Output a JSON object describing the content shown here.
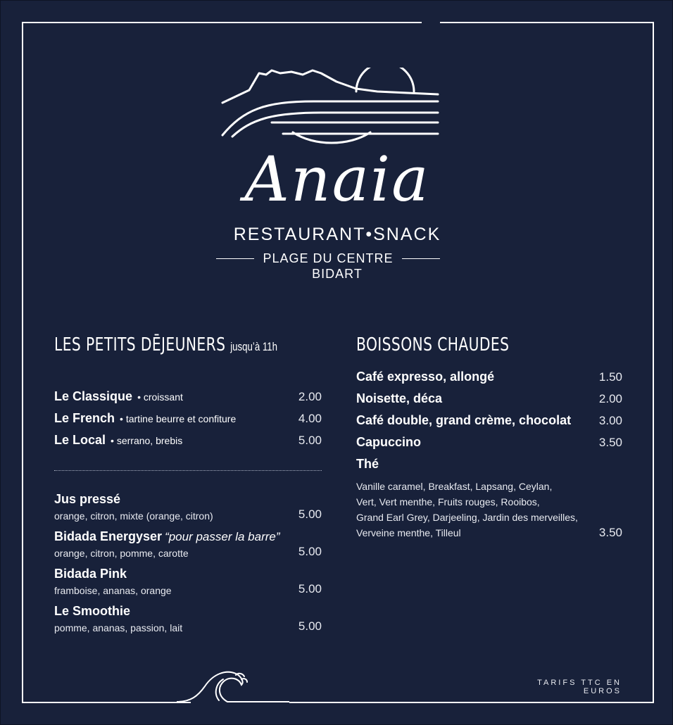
{
  "brand": {
    "name": "Anaia",
    "subtitle": "RESTAURANT•SNACK",
    "place": "PLAGE DU CENTRE",
    "city": "BIDART"
  },
  "breakfast": {
    "title": "LES PETITS DĒJEUNERS",
    "note": "jusqu’à 11h",
    "items": [
      {
        "name": "Le Classique",
        "desc": "• croissant",
        "price": "2.00"
      },
      {
        "name": "Le French",
        "desc": "• tartine beurre et confiture",
        "price": "4.00"
      },
      {
        "name": "Le Local",
        "desc": "• serrano, brebis",
        "price": "5.00"
      }
    ],
    "juices": [
      {
        "name": "Jus pressé",
        "quote": "",
        "desc": "orange, citron, mixte (orange, citron)",
        "price": "5.00"
      },
      {
        "name": "Bidada Energyser",
        "quote": "“pour passer la barre”",
        "desc": "orange, citron, pomme, carotte",
        "price": "5.00"
      },
      {
        "name": "Bidada Pink",
        "quote": "",
        "desc": "framboise, ananas, orange",
        "price": "5.00"
      },
      {
        "name": "Le Smoothie",
        "quote": "",
        "desc": "pomme, ananas, passion, lait",
        "price": "5.00"
      }
    ]
  },
  "hot_drinks": {
    "title": "BOISSONS CHAUDES",
    "items": [
      {
        "name": "Café expresso, allongé",
        "price": "1.50"
      },
      {
        "name": "Noisette, déca",
        "price": "2.00"
      },
      {
        "name": "Café double, grand crème, chocolat",
        "price": "3.00"
      },
      {
        "name": "Capuccino",
        "price": "3.50"
      }
    ],
    "tea": {
      "name": "Thé",
      "lines": [
        "Vanille caramel, Breakfast, Lapsang, Ceylan,",
        "Vert, Vert menthe, Fruits rouges, Rooibos,",
        "Grand Earl Grey, Darjeeling, Jardin des merveilles,"
      ],
      "last_line": "Verveine menthe, Tilleul",
      "price": "3.50"
    }
  },
  "footer": {
    "note": "TARIFS TTC EN EUROS"
  },
  "colors": {
    "background": "#18213a",
    "foreground": "#ffffff"
  },
  "icons": {
    "logo": "sunset-sea-logo-icon",
    "wave": "wave-icon"
  }
}
